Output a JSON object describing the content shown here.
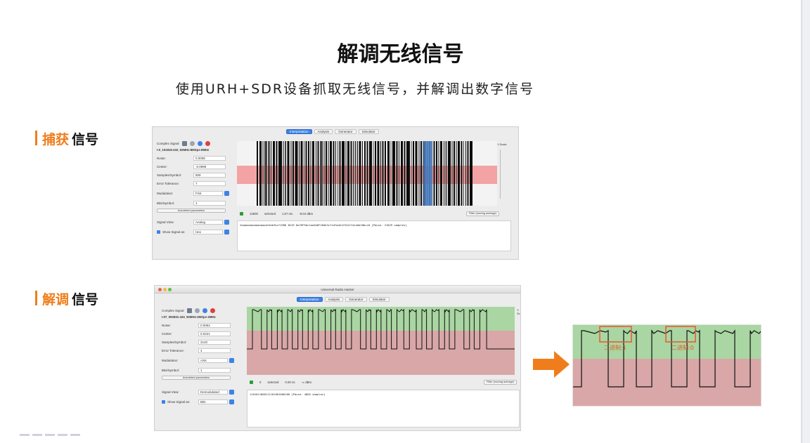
{
  "slide": {
    "title": "解调无线信号",
    "subtitle": "使用URH+SDR设备抓取无线信号，并解调出数字信号"
  },
  "sections": {
    "capture": {
      "highlight": "捕获",
      "rest": "信号"
    },
    "demod": {
      "highlight": "解调",
      "rest": "信号"
    }
  },
  "capture_shot": {
    "tabs": [
      "Interpretation",
      "Analysis",
      "Generator",
      "Simulator"
    ],
    "signal_header": "Complex Signal",
    "filename": "I-0_101816-433_92MHz-8MSps-8MHz",
    "fields": [
      {
        "label": "Noise:",
        "value": "0.0008"
      },
      {
        "label": "Center:",
        "value": "-0.0999"
      },
      {
        "label": "Samples/Symbol:",
        "value": "809"
      },
      {
        "label": "Error Tolerance:",
        "value": "7"
      }
    ],
    "modulation": {
      "label": "Modulation:",
      "value": "FSK"
    },
    "bits_symbol": {
      "label": "Bits/Symbol:",
      "value": "1"
    },
    "autodetect_label": "Autodetect parameters",
    "signal_view": {
      "label": "Signal View:",
      "value": "Analog"
    },
    "show_signal_as": {
      "label": "Show Signal as:",
      "value": "Hex"
    },
    "status": {
      "selected": "12500",
      "selected_label": "selected",
      "time": "1.57 ms",
      "power": "-8.04 dBm"
    },
    "filter_label": "Filter (moving average)",
    "bits_text": "2aaaaaaaaaaaaaaaafebbfbcf1986 8C49 8a76F9bc1aa3b6F1B4b3cf1dfade125faf12e4dd18bcc0 [Pause: 21829 samples]",
    "y_scale_label": "Y-Scale",
    "bars": [
      2,
      3,
      1,
      4,
      2,
      1,
      3,
      2,
      5,
      1,
      2,
      3,
      1,
      2,
      4,
      1,
      3,
      1,
      2,
      2,
      1,
      3,
      1,
      2,
      4,
      1,
      2,
      1,
      3,
      2,
      1,
      1,
      2,
      4,
      1,
      3,
      2,
      1,
      2,
      1,
      3,
      1,
      2,
      2,
      4,
      1,
      2,
      3,
      1,
      2
    ]
  },
  "demod_shot": {
    "window_title": "Universal Radio Hacker",
    "tabs": [
      "Interpretation",
      "Analysis",
      "Generator",
      "Simulator"
    ],
    "signal_header": "Complex Signal",
    "filename": "I-07_092831-433_92MHz-2MSps-2MHz",
    "fields": [
      {
        "label": "Noise:",
        "value": "0.0064"
      },
      {
        "label": "Center:",
        "value": "0.0221"
      },
      {
        "label": "Samples/Symbol:",
        "value": "2140"
      },
      {
        "label": "Error Tolerance:",
        "value": "4"
      }
    ],
    "modulation": {
      "label": "Modulation:",
      "value": "ASK"
    },
    "bits_symbol": {
      "label": "Bits/Symbol:",
      "value": "1"
    },
    "autodetect_label": "Autodetect parameters",
    "signal_view": {
      "label": "Signal View:",
      "value": "Demodulated"
    },
    "show_signal_as": {
      "label": "Show Signal as:",
      "value": "Bits"
    },
    "status": {
      "selected": "0",
      "selected_label": "selected",
      "time": "0.00 ns",
      "power": "-∞ dBm"
    },
    "filter_label": "Filter (moving average)",
    "bits_text": "1101011000111101001000100 [Pause: 4805 samples]",
    "y_scale_label": "Y-Sc",
    "pulses": [
      3,
      1,
      1,
      1,
      1,
      1,
      2,
      1,
      1,
      3,
      1,
      1,
      1,
      2,
      2,
      1,
      2,
      1,
      3,
      1,
      2
    ]
  },
  "zoom": {
    "label_left": "二进制:1",
    "label_right": "二进制:0",
    "pulses": [
      3,
      1,
      2,
      1,
      2,
      1
    ]
  },
  "colors": {
    "accent": "#f07d1b",
    "selected_blue": "#3d82e6",
    "noise_band": "#f3a3a3",
    "upper_band": "#a9d6a2",
    "lower_band": "#d9a7a7",
    "annotation": "#e8582a"
  }
}
